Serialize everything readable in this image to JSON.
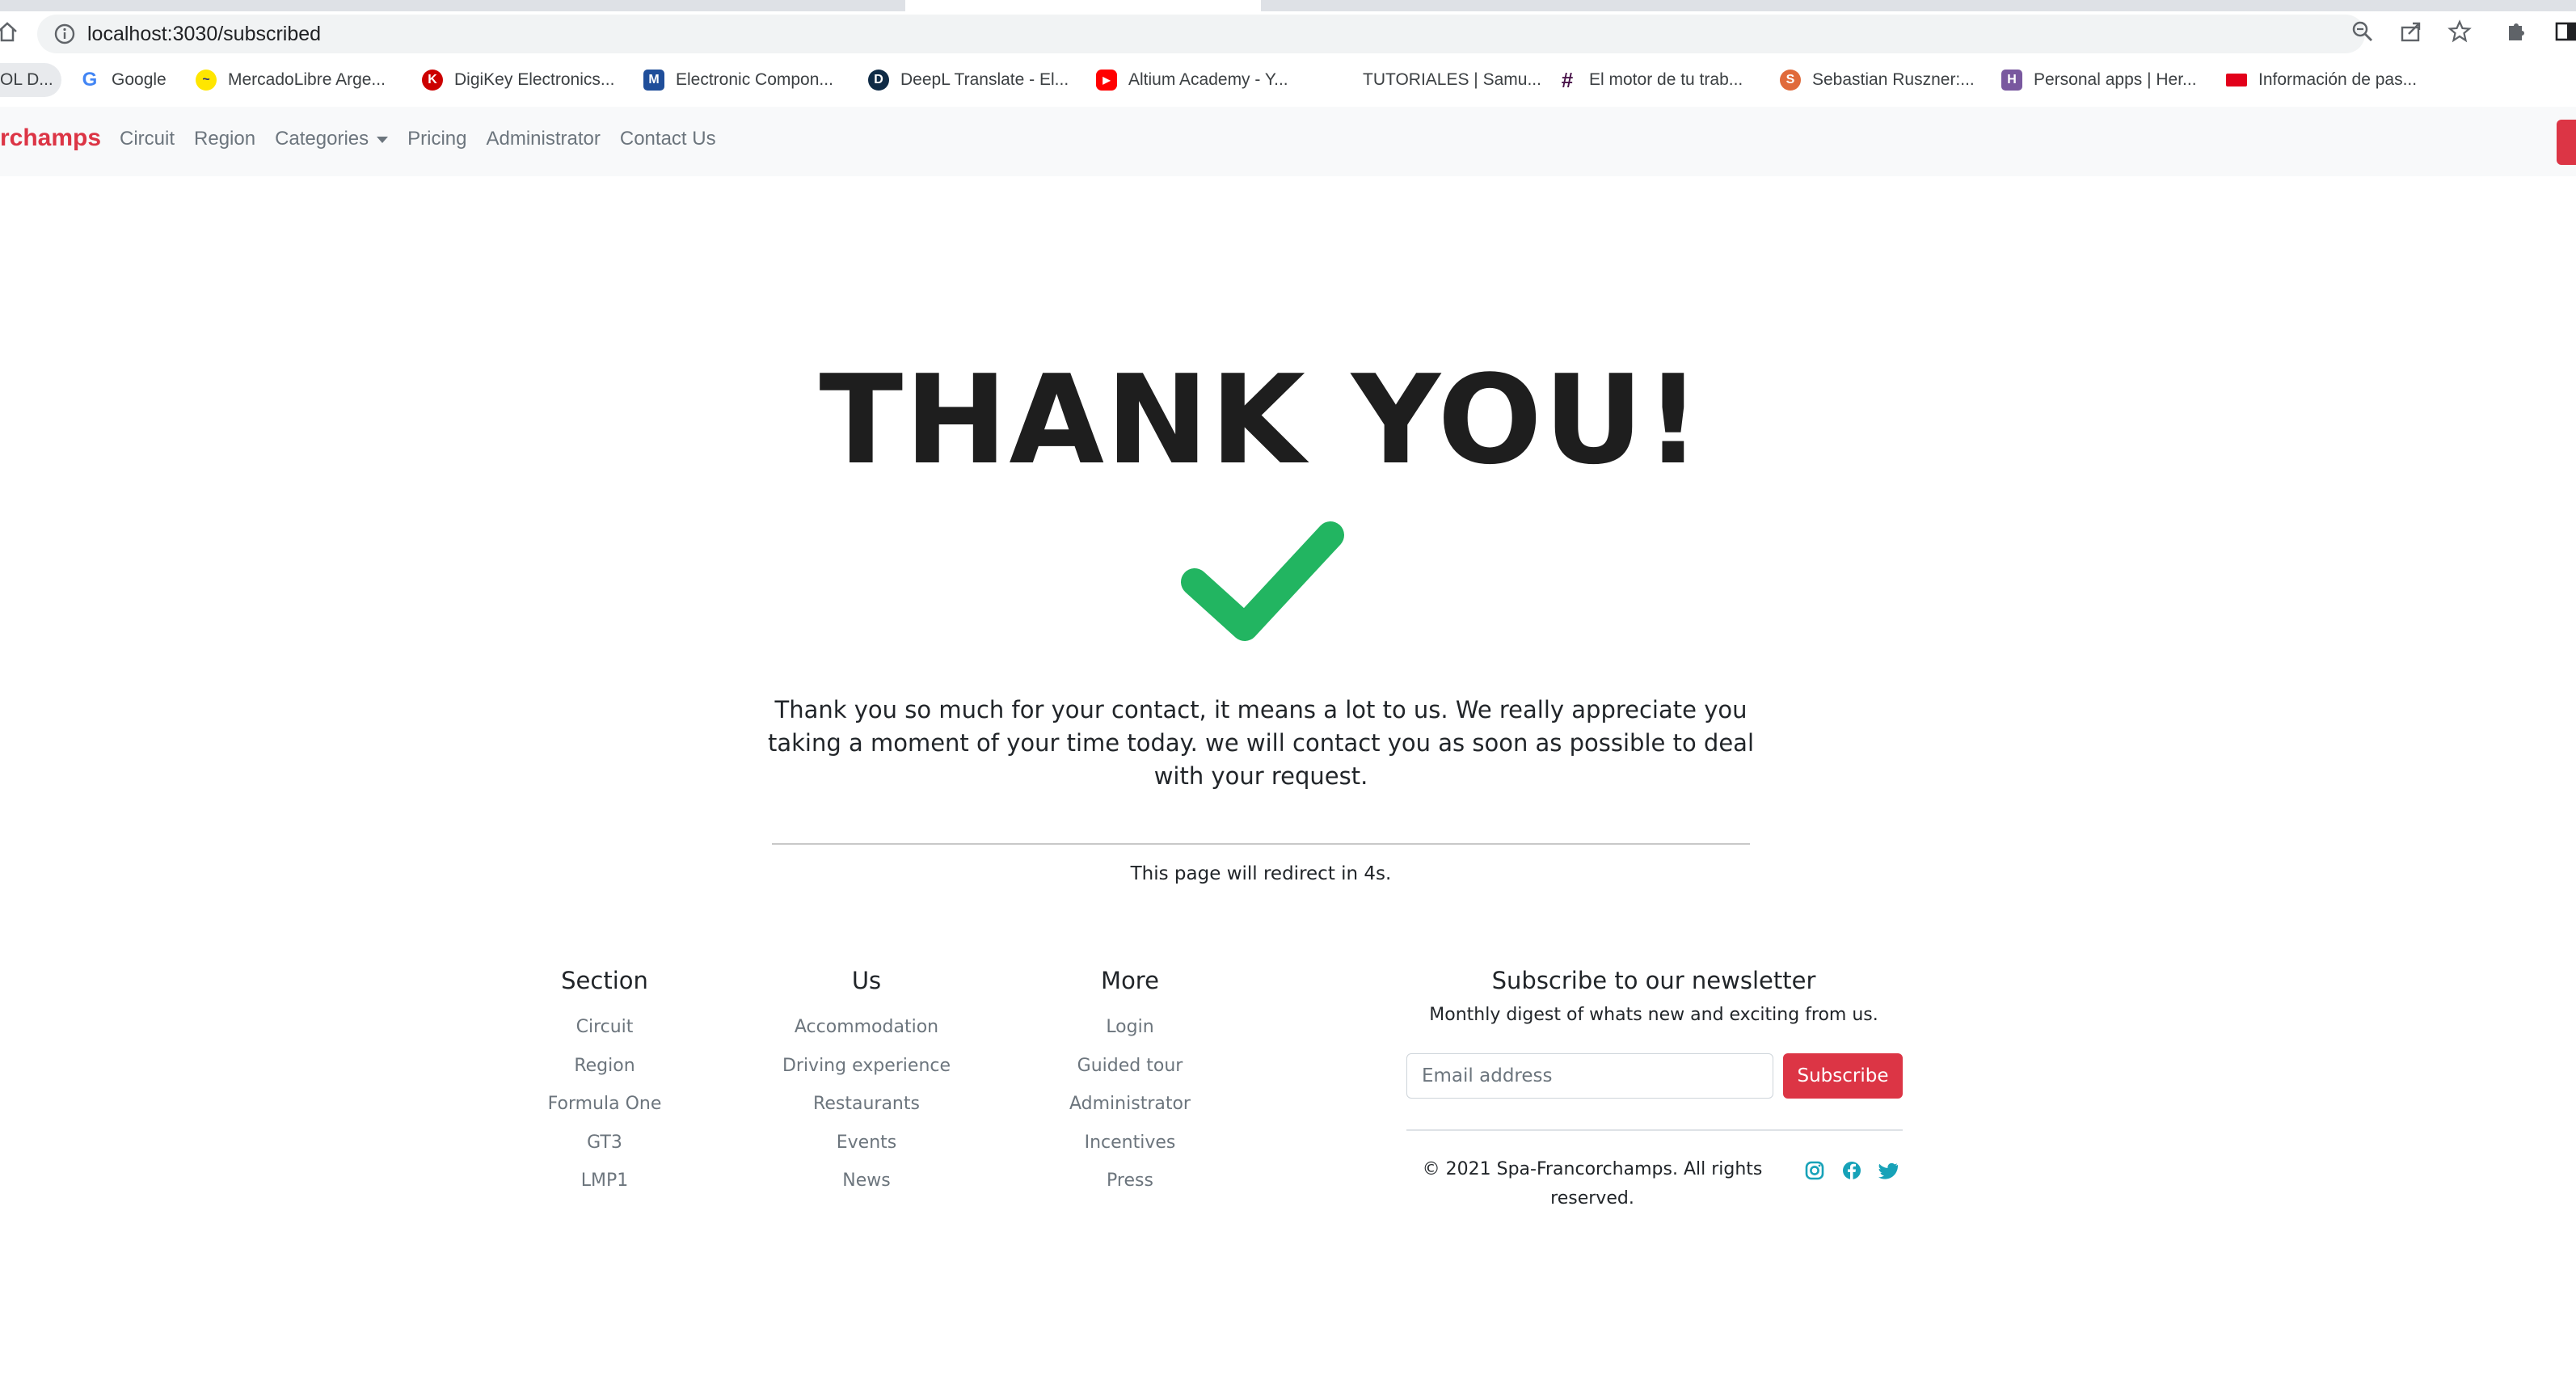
{
  "browser": {
    "url": "localhost:3030/subscribed",
    "bookmarks": [
      {
        "label": "OL D...",
        "icon": "folder-icon"
      },
      {
        "label": "Google",
        "icon": "google-icon"
      },
      {
        "label": "MercadoLibre Arge...",
        "icon": "mercadolibre-icon"
      },
      {
        "label": "DigiKey Electronics...",
        "icon": "digikey-icon"
      },
      {
        "label": "Electronic Compon...",
        "icon": "electronic-components-icon"
      },
      {
        "label": "DeepL Translate - El...",
        "icon": "deepl-icon"
      },
      {
        "label": "Altium Academy - Y...",
        "icon": "youtube-icon"
      },
      {
        "label": "TUTORIALES | Samu...",
        "icon": "none"
      },
      {
        "label": "El motor de tu trab...",
        "icon": "slack-icon"
      },
      {
        "label": "Sebastian Ruszner:...",
        "icon": "profile-icon"
      },
      {
        "label": "Personal apps | Her...",
        "icon": "heroku-icon"
      },
      {
        "label": "Información de pas...",
        "icon": "flag-icon"
      }
    ]
  },
  "navbar": {
    "brand": "rchamps",
    "links": [
      "Circuit",
      "Region",
      "Categories",
      "Pricing",
      "Administrator",
      "Contact Us"
    ]
  },
  "main": {
    "title": "THANK YOU!",
    "message": "Thank you so much for your contact, it means a lot to us. We really appreciate you taking a moment of your time today. we will contact you as soon as possible to deal with your request.",
    "redirect": "This page will redirect in 4s.",
    "check_color": "#22b561"
  },
  "footer": {
    "columns": [
      {
        "heading": "Section",
        "links": [
          "Circuit",
          "Region",
          "Formula One",
          "GT3",
          "LMP1"
        ]
      },
      {
        "heading": "Us",
        "links": [
          "Accommodation",
          "Driving experience",
          "Restaurants",
          "Events",
          "News"
        ]
      },
      {
        "heading": "More",
        "links": [
          "Login",
          "Guided tour",
          "Administrator",
          "Incentives",
          "Press"
        ]
      }
    ],
    "newsletter": {
      "heading": "Subscribe to our newsletter",
      "subheading": "Monthly digest of whats new and exciting from us.",
      "email_placeholder": "Email address",
      "button": "Subscribe"
    },
    "copyright": "© 2021 Spa-Francorchamps. All rights reserved.",
    "social": [
      "instagram-icon",
      "facebook-icon",
      "twitter-icon"
    ],
    "accent": "#dc3545",
    "social_color": "#17a2b8"
  }
}
